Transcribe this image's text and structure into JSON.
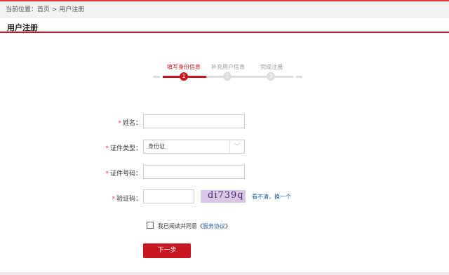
{
  "breadcrumb": "当前位置：首页 > 用户注册",
  "title": "用户注册",
  "steps": [
    {
      "label": "填写身份信息",
      "num": "1"
    },
    {
      "label": "补充用户信息",
      "num": "2"
    },
    {
      "label": "完成注册",
      "num": "3"
    }
  ],
  "form": {
    "name_label": "姓名：",
    "idtype_label": "证件类型：",
    "idtype_value": "身份证",
    "idnum_label": "证件号码：",
    "captcha_label": "验证码：",
    "captcha_text": "di739q",
    "refresh_label": "看不清，换一个",
    "required_mark": "*"
  },
  "agreement": {
    "prefix": "我已阅读并同意《",
    "link": "服务协议",
    "suffix": "》"
  },
  "next_button": "下一步",
  "colors": {
    "accent": "#c81623",
    "link": "#1e5aa8"
  },
  "icons": {
    "select_arrow": "chevron-down-icon"
  }
}
